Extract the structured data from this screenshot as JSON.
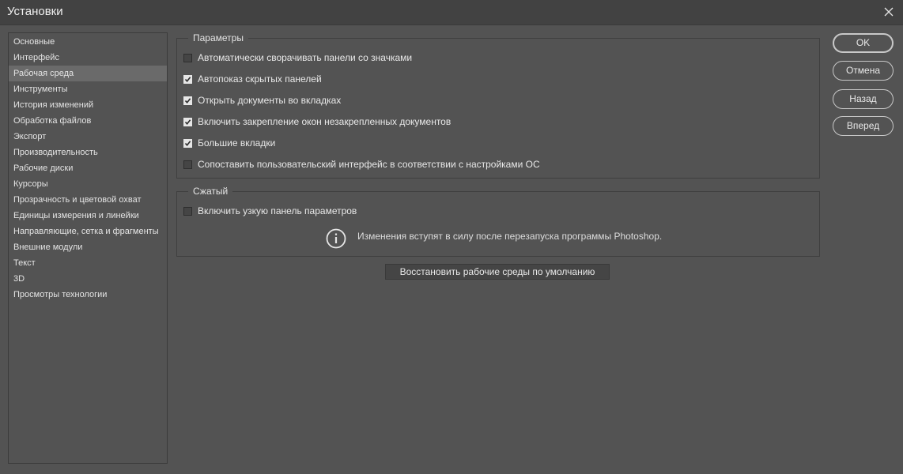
{
  "window": {
    "title": "Установки"
  },
  "sidebar": {
    "items": [
      {
        "label": "Основные"
      },
      {
        "label": "Интерфейс"
      },
      {
        "label": "Рабочая среда",
        "selected": true
      },
      {
        "label": "Инструменты"
      },
      {
        "label": "История изменений"
      },
      {
        "label": "Обработка файлов"
      },
      {
        "label": "Экспорт"
      },
      {
        "label": "Производительность"
      },
      {
        "label": "Рабочие диски"
      },
      {
        "label": "Курсоры"
      },
      {
        "label": "Прозрачность и цветовой охват"
      },
      {
        "label": "Единицы измерения и линейки"
      },
      {
        "label": "Направляющие, сетка и фрагменты"
      },
      {
        "label": "Внешние модули"
      },
      {
        "label": "Текст"
      },
      {
        "label": "3D"
      },
      {
        "label": "Просмотры технологии"
      }
    ]
  },
  "options_group": {
    "legend": "Параметры",
    "checkboxes": [
      {
        "label": "Автоматически сворачивать панели со значками",
        "checked": false
      },
      {
        "label": "Автопоказ скрытых панелей",
        "checked": true
      },
      {
        "label": "Открыть документы во вкладках",
        "checked": true
      },
      {
        "label": "Включить закрепление окон незакрепленных документов",
        "checked": true
      },
      {
        "label": "Большие вкладки",
        "checked": true
      },
      {
        "label": "Сопоставить пользовательский интерфейс в соответствии с настройками ОС",
        "checked": false
      }
    ]
  },
  "compact_group": {
    "legend": "Сжатый",
    "checkbox": {
      "label": "Включить узкую панель параметров",
      "checked": false
    },
    "info_text": "Изменения вступят в силу после перезапуска программы Photoshop."
  },
  "restore_button": "Восстановить рабочие среды по умолчанию",
  "buttons": {
    "ok": "OK",
    "cancel": "Отмена",
    "back": "Назад",
    "forward": "Вперед"
  },
  "colors": {
    "background": "#535353",
    "titlebar": "#424242",
    "selected_item": "#6a6a6a"
  }
}
